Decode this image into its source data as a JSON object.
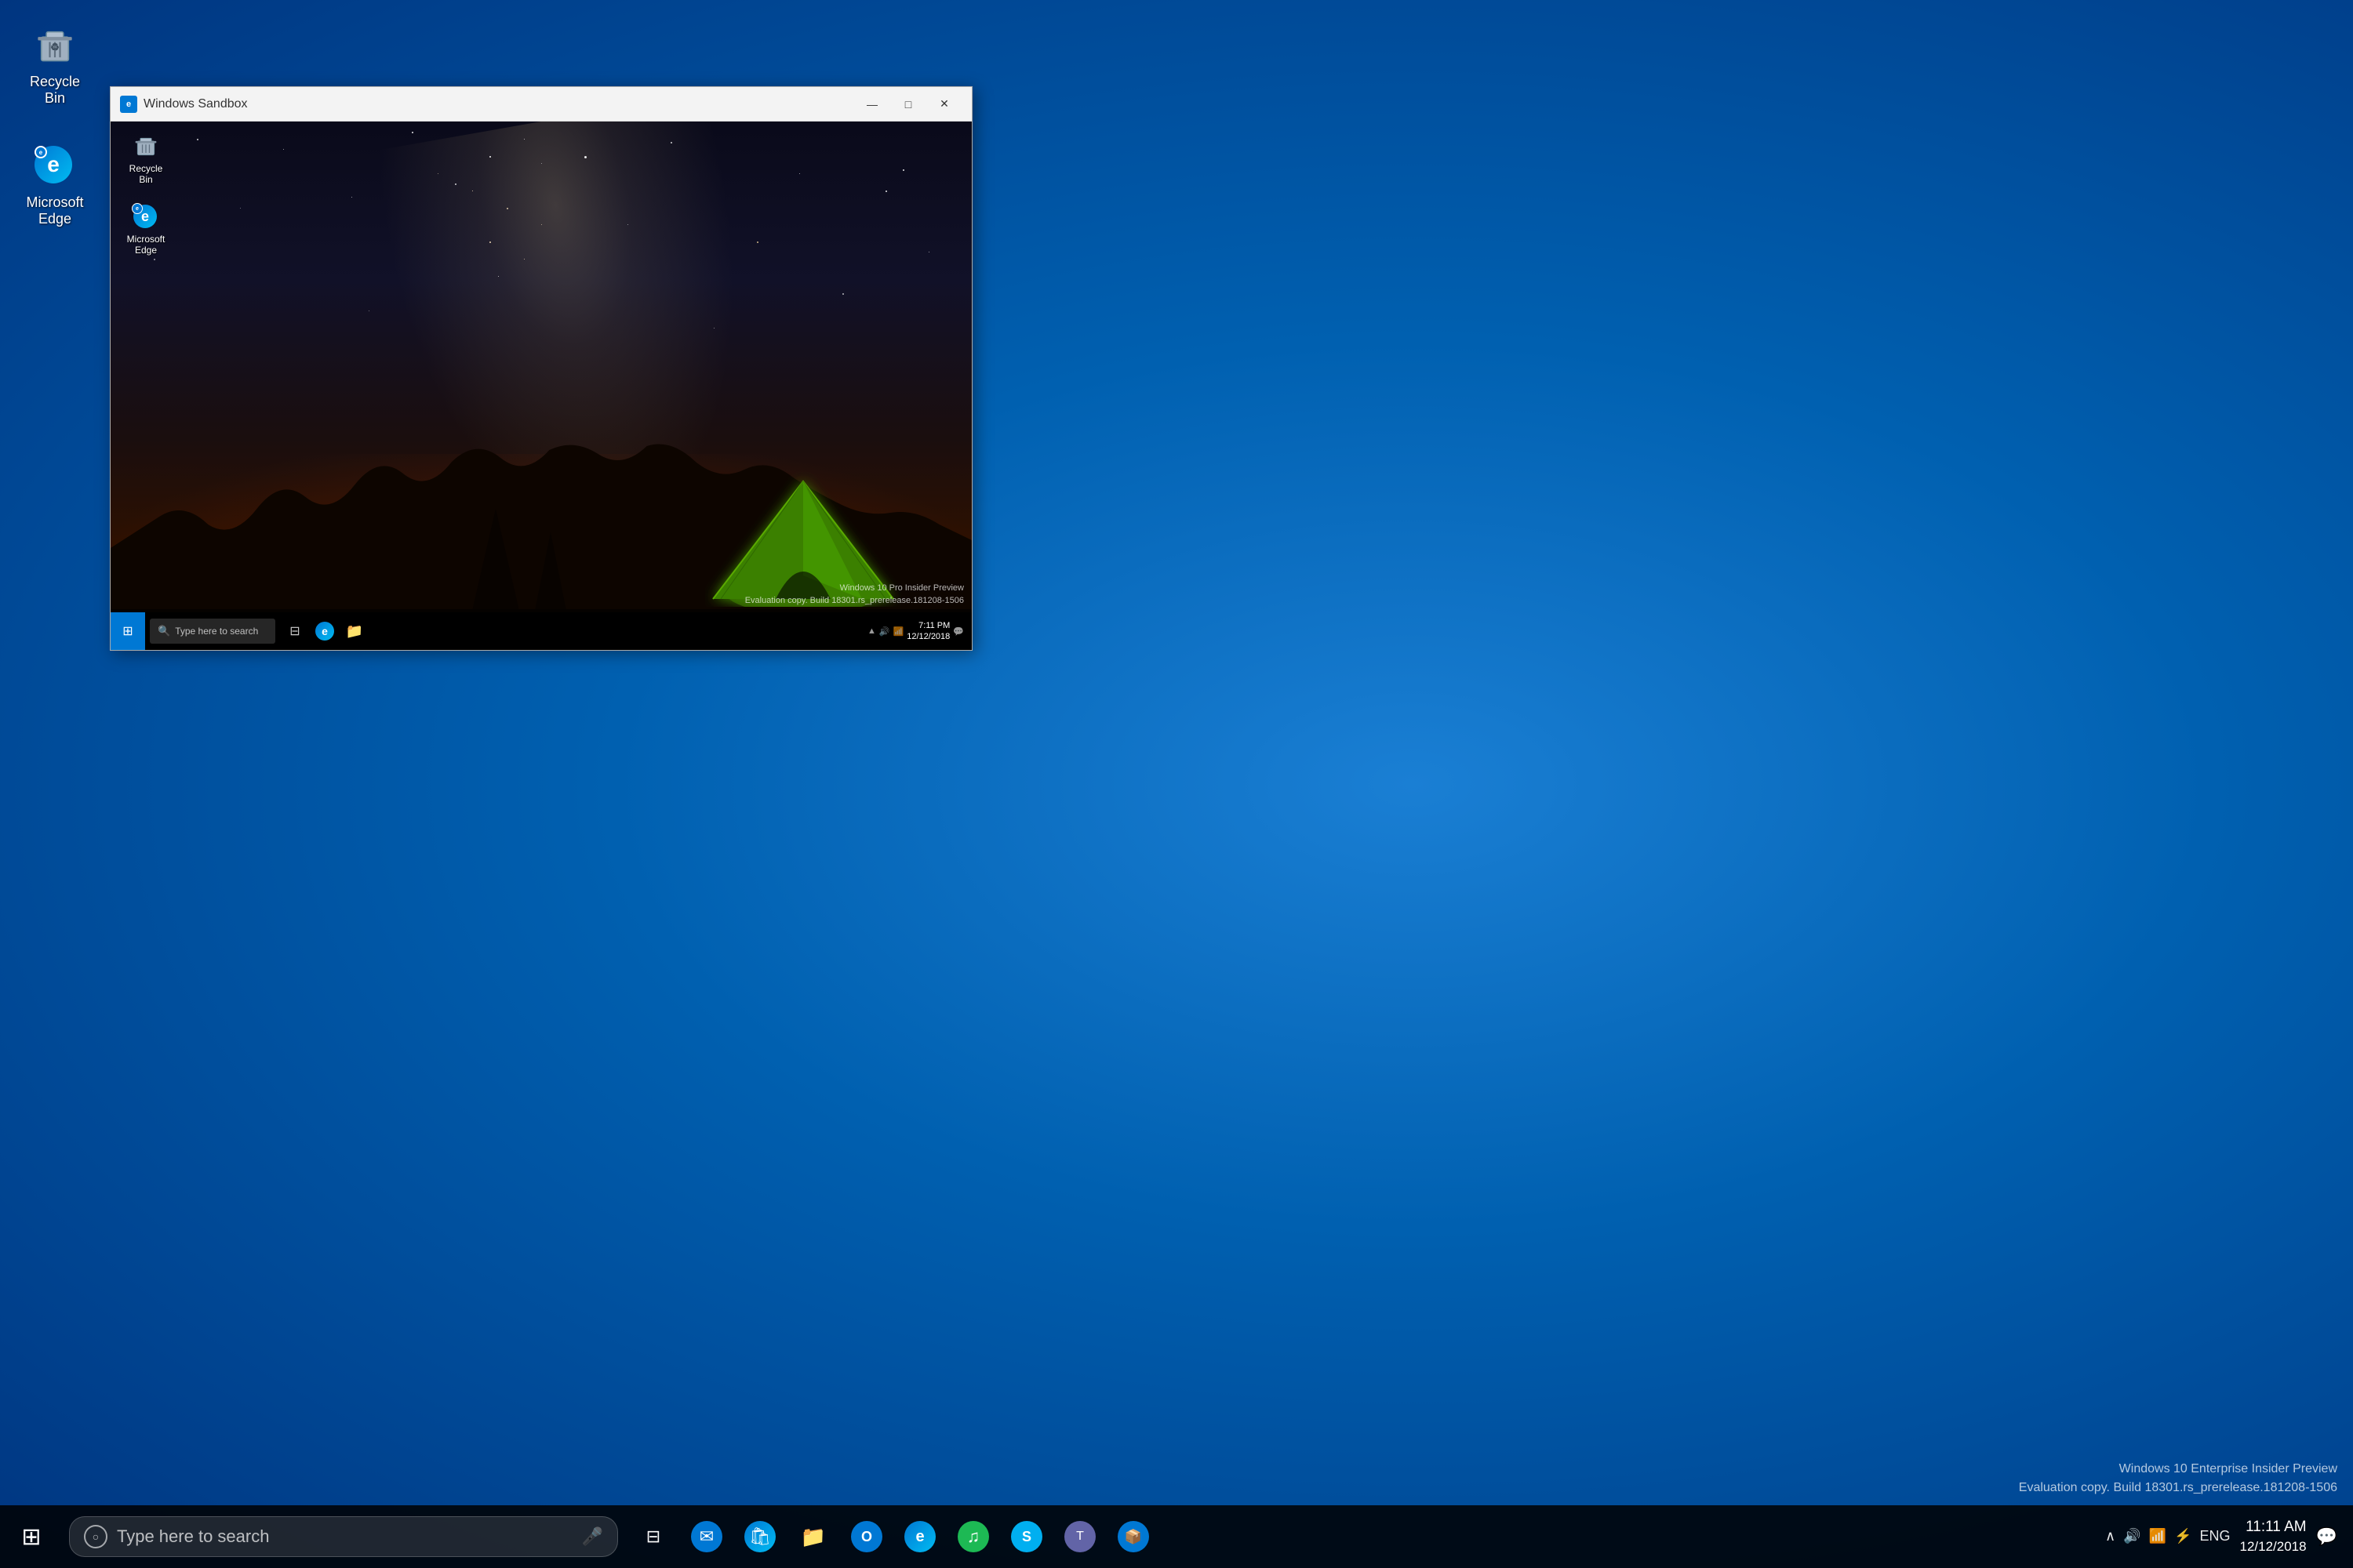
{
  "desktop": {
    "background": "blue gradient",
    "icons": [
      {
        "id": "recycle-bin",
        "label": "Recycle Bin",
        "icon": "recycle-bin-icon"
      },
      {
        "id": "microsoft-edge",
        "label": "Microsoft Edge",
        "icon": "edge-icon"
      }
    ]
  },
  "sandbox_window": {
    "title": "Windows Sandbox",
    "inner_icons": [
      {
        "id": "recycle-bin-inner",
        "label": "Recycle Bin",
        "icon": "recycle-bin-icon"
      },
      {
        "id": "microsoft-edge-inner",
        "label": "Microsoft Edge",
        "icon": "edge-icon"
      }
    ],
    "inner_taskbar": {
      "search_placeholder": "Type here to search",
      "clock": {
        "time": "7:11 PM",
        "date": "12/12/2018"
      }
    },
    "watermark": {
      "line1": "Windows 10 Pro Insider Preview",
      "line2": "Evaluation copy. Build 18301.rs_prerelease.181208-1506"
    }
  },
  "host_taskbar": {
    "search_placeholder": "Type here to search",
    "icons": [
      {
        "id": "task-view",
        "label": "Task View",
        "icon": "task-view-icon"
      },
      {
        "id": "mail",
        "label": "Mail",
        "icon": "mail-icon"
      },
      {
        "id": "store",
        "label": "Microsoft Store",
        "icon": "store-icon"
      },
      {
        "id": "folder",
        "label": "File Explorer",
        "icon": "folder-icon"
      },
      {
        "id": "outlook",
        "label": "Outlook",
        "icon": "outlook-icon"
      },
      {
        "id": "edge",
        "label": "Microsoft Edge",
        "icon": "edge-icon"
      },
      {
        "id": "spotify",
        "label": "Spotify",
        "icon": "spotify-icon"
      },
      {
        "id": "skype",
        "label": "Skype",
        "icon": "skype-icon"
      },
      {
        "id": "teams",
        "label": "Microsoft Teams",
        "icon": "teams-icon"
      },
      {
        "id": "app",
        "label": "App",
        "icon": "app-icon"
      }
    ],
    "systray": {
      "clock": {
        "time": "11:11 AM",
        "date": "12/12/2018"
      }
    }
  },
  "host_watermark": {
    "line1": "Windows 10 Enterprise Insider Preview",
    "line2": "Evaluation copy. Build 18301.rs_prerelease.181208-1506"
  },
  "window_controls": {
    "minimize": "—",
    "maximize": "□",
    "close": "✕"
  }
}
